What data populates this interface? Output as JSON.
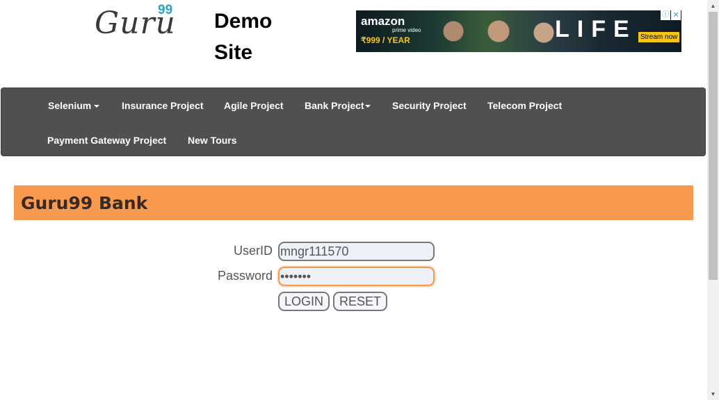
{
  "header": {
    "logo_text": "Guru",
    "logo_sup": "99",
    "site_title_line1": "Demo",
    "site_title_line2": "Site"
  },
  "ad": {
    "brand": "amazon",
    "sub": "prime video",
    "price": "₹999",
    "price_suffix": "/ YEAR",
    "title": "LIFE",
    "cta": "Stream now"
  },
  "nav": {
    "row1": [
      "Selenium",
      "Insurance Project",
      "Agile Project",
      "Bank Project",
      "Security Project",
      "Telecom Project"
    ],
    "row2": [
      "Payment Gateway Project",
      "New Tours"
    ]
  },
  "banner": {
    "title": "Guru99 Bank"
  },
  "form": {
    "userid_label": "UserID",
    "userid_value": "mngr111570",
    "password_label": "Password",
    "password_value": "•••••••",
    "login_label": "LOGIN",
    "reset_label": "RESET"
  },
  "colors": {
    "nav_bg": "#505050",
    "banner_bg": "#f7994e",
    "logo_accent": "#2fa3c6"
  }
}
